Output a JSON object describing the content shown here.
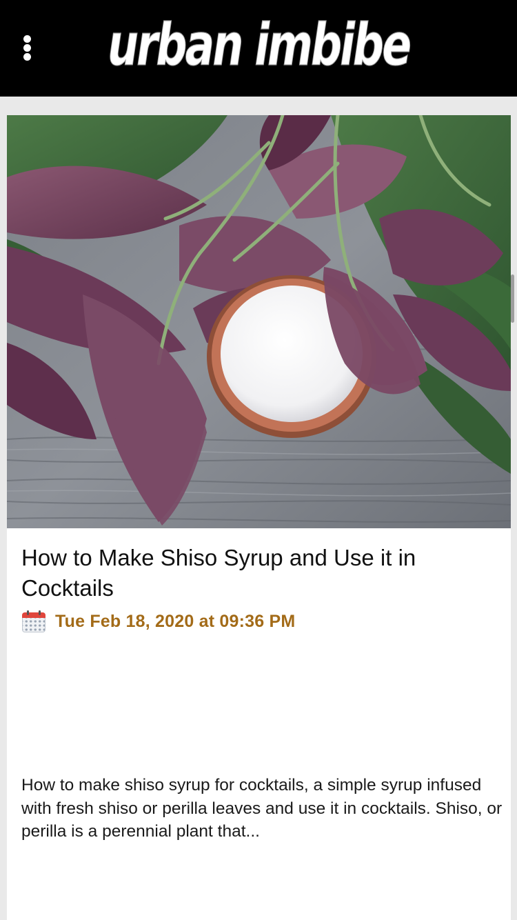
{
  "header": {
    "logo_text": "urban imbibe",
    "menu_icon": "vertical-dots-icon"
  },
  "post": {
    "title": "How to Make Shiso Syrup and Use it in Cocktails",
    "date_icon": "calendar-icon",
    "date": "Tue Feb 18, 2020 at 09:36 PM",
    "excerpt": "How to make shiso syrup for cocktails, a simple syrup infused with fresh shiso or perilla leaves and use it in cocktails. Shiso, or perilla is a perennial plant that..."
  },
  "colors": {
    "header_bg": "#000000",
    "page_bg": "#e9e9e9",
    "card_bg": "#ffffff",
    "date_text": "#a36b18",
    "title_text": "#111111"
  }
}
